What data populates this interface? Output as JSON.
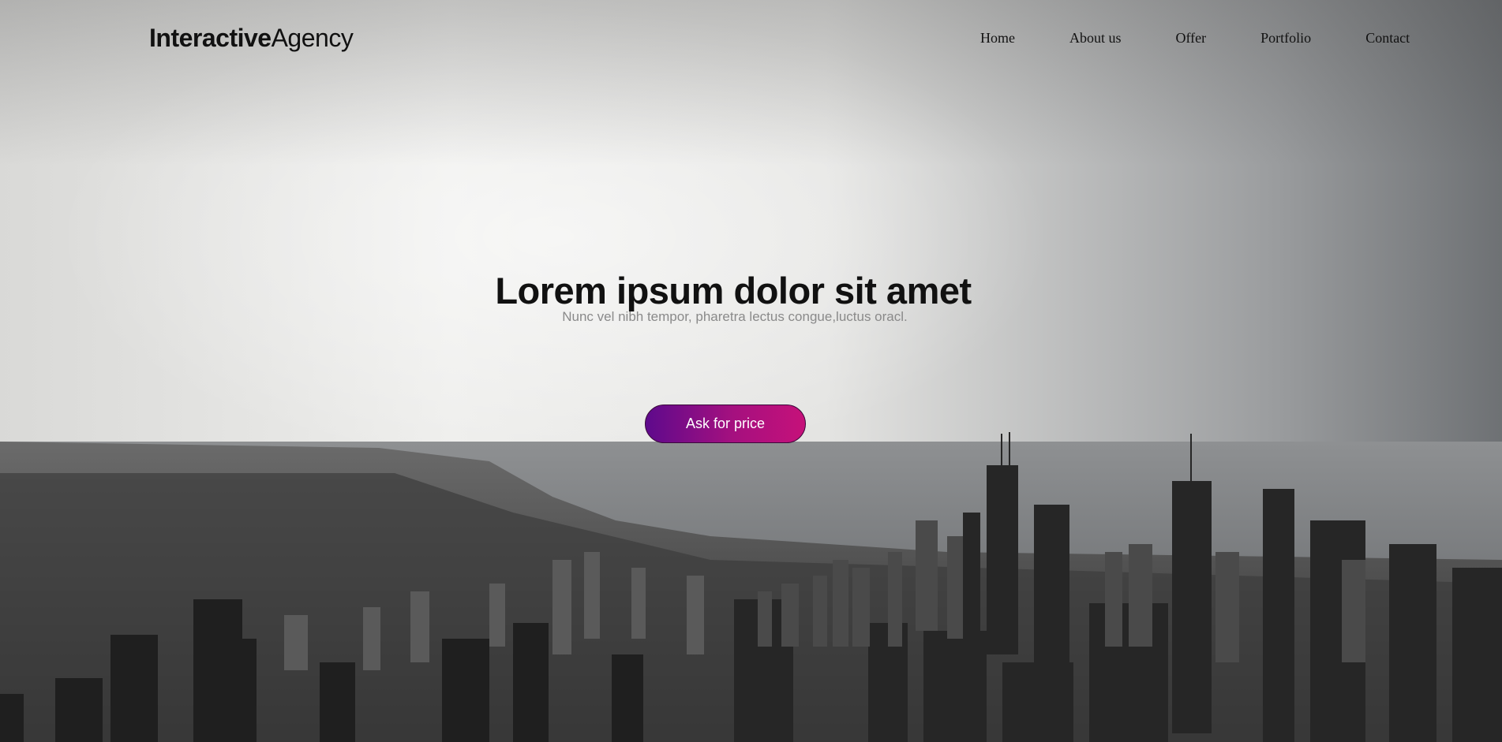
{
  "brand": {
    "bold": "Interactive",
    "light": "Agency"
  },
  "nav": {
    "items": [
      {
        "label": "Home"
      },
      {
        "label": "About us"
      },
      {
        "label": "Offer"
      },
      {
        "label": "Portfolio"
      },
      {
        "label": "Contact"
      }
    ]
  },
  "hero": {
    "title": "Lorem ipsum dolor sit amet",
    "subtitle": "Nunc vel nibh tempor, pharetra lectus congue,luctus oracl.",
    "cta_label": "Ask for price"
  },
  "colors": {
    "cta_start": "#5e0a8c",
    "cta_end": "#c6117a"
  }
}
